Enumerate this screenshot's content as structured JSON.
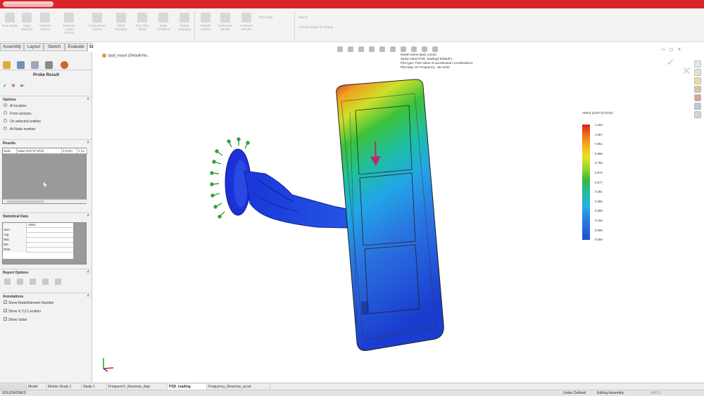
{
  "window": {
    "title_bar_color": "#d9252a"
  },
  "ribbon": {
    "commands": [
      {
        "label": "New Study",
        "icon": "new-study-icon"
      },
      {
        "label": "Apply Material",
        "icon": "material-icon"
      },
      {
        "label": "Fixtures Advisor",
        "icon": "fixtures-icon"
      },
      {
        "label": "External Loads Advisor",
        "icon": "loads-icon"
      },
      {
        "label": "Connections Advisor",
        "icon": "connections-icon"
      },
      {
        "label": "Shell Manager",
        "icon": "shell-icon"
      },
      {
        "label": "Run This Study",
        "icon": "run-icon"
      },
      {
        "label": "Initial Condition",
        "icon": "initial-icon"
      },
      {
        "label": "Global Damping",
        "icon": "damping-icon"
      },
      {
        "label": "Results Advisor",
        "icon": "results-advisor-icon"
      },
      {
        "label": "Deformed Result",
        "icon": "deformed-icon"
      },
      {
        "label": "Compare Results",
        "icon": "compare-icon"
      }
    ],
    "plot_tools": "Plot Tools",
    "report": "Report",
    "include_image": "Include Image for Report"
  },
  "tabs": [
    "Assembly",
    "Layout",
    "Sketch",
    "Evaluate",
    "Simulation"
  ],
  "active_tab": "Simulation",
  "probe": {
    "title": "Probe Result",
    "options_header": "Options",
    "options": [
      "At location",
      "From sensors",
      "On selected entities",
      "At Node number"
    ],
    "results_header": "Results",
    "results_columns": [
      "Node",
      "Value (m/s^2)^2/Hz)",
      "X (mm)",
      "Y (m"
    ],
    "stats_header": "Statistical Data",
    "stats_value_header": "Value",
    "stats_rows": [
      "Sum",
      "Avg",
      "Max",
      "Min",
      "RMS"
    ],
    "report_header": "Report Options",
    "annotations_header": "Annotations",
    "annotations": [
      "Show Node/Element Number",
      "Show X,Y,Z Location",
      "Show Value"
    ]
  },
  "viewport": {
    "breadcrumb": "Ipad_mount (Default<No...",
    "info_lines": [
      "Model name:Ipad_mount",
      "Study name:PSD_loading(-Default-)",
      "Plot type: PSD Value of acceleration Acceleration1",
      "Plot step: 91 Frequency : 66 Hertz"
    ]
  },
  "legend": {
    "title": "ARES ((m/s^2)^2/Hz)",
    "values": [
      "1.153",
      "1.057",
      "0.961",
      "0.865",
      "0.769",
      "0.673",
      "0.577",
      "0.481",
      "0.385",
      "0.289",
      "0.193",
      "0.096",
      "0.000"
    ]
  },
  "bottom_tabs": [
    "Model",
    "Motion Study 1",
    "Study 1",
    "FrequencY_Resonse_disp",
    "PSD_loading",
    "Frequency_Resonse_accel"
  ],
  "active_bottom_tab": "PSD_loading",
  "status": {
    "app": "SOLIDWORKS",
    "state": "Under Defined",
    "mode": "Editing Assembly",
    "units": "MMGS"
  }
}
